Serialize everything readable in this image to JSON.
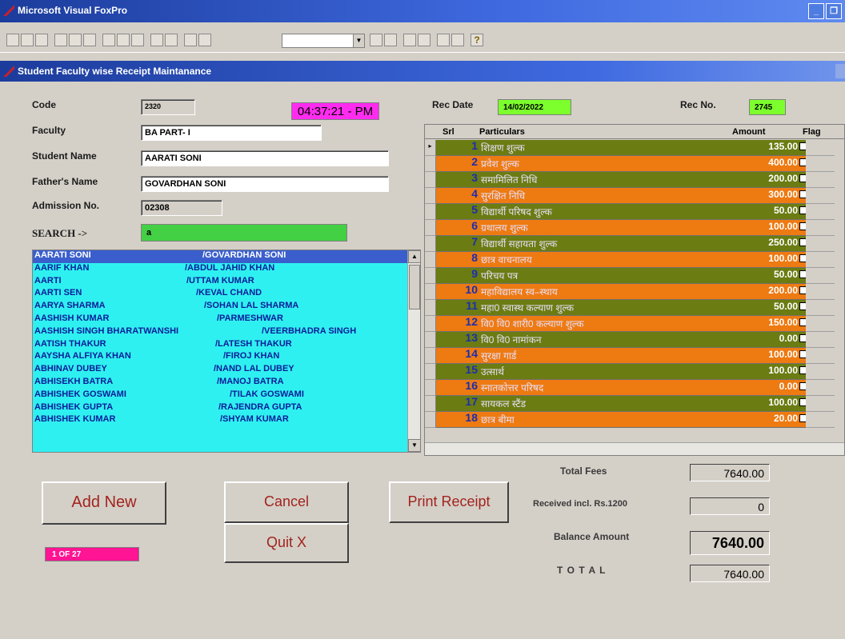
{
  "app": {
    "title": "Microsoft Visual FoxPro"
  },
  "form": {
    "title": "Student Faculty wise Receipt Maintanance"
  },
  "labels": {
    "code": "Code",
    "faculty": "Faculty",
    "student_name": "Student Name",
    "father_name": "Father's Name",
    "admission_no": "Admission No.",
    "search": "SEARCH ->",
    "rec_date": "Rec Date",
    "rec_no": "Rec No.",
    "total_fees": "Total Fees",
    "received": "Received incl. Rs.1200",
    "balance": "Balance Amount",
    "total": "T O T A L"
  },
  "fields": {
    "code": "2320",
    "clock": "04:37:21 - PM",
    "faculty": "BA PART- I",
    "student_name": "AARATI SONI",
    "father_name": "GOVARDHAN SONI",
    "admission_no": "02308",
    "search": "a",
    "rec_date": "14/02/2022",
    "rec_no": "2745",
    "total_fees": "7640.00",
    "received": "0",
    "balance": "7640.00",
    "total": "7640.00",
    "record_pos": "1  OF   27"
  },
  "student_list": [
    {
      "name": "AARATI SONI",
      "father": "/GOVARDHAN SONI",
      "selected": true
    },
    {
      "name": "AARIF KHAN",
      "father": "/ABDUL JAHID KHAN"
    },
    {
      "name": "AARTI",
      "father": "/UTTAM KUMAR"
    },
    {
      "name": "AARTI SEN",
      "father": "/KEVAL CHAND"
    },
    {
      "name": "AARYA SHARMA",
      "father": "/SOHAN LAL SHARMA"
    },
    {
      "name": "AASHISH KUMAR",
      "father": "/PARMESHWAR"
    },
    {
      "name": "AASHISH SINGH BHARATWANSHI",
      "father": "/VEERBHADRA SINGH"
    },
    {
      "name": "AATISH THAKUR",
      "father": "/LATESH THAKUR"
    },
    {
      "name": "AAYSHA ALFIYA KHAN",
      "father": "/FIROJ KHAN"
    },
    {
      "name": "ABHINAV DUBEY",
      "father": "/NAND LAL DUBEY"
    },
    {
      "name": "ABHISEKH BATRA",
      "father": "/MANOJ BATRA"
    },
    {
      "name": "ABHISHEK GOSWAMI",
      "father": "/TILAK GOSWAMI"
    },
    {
      "name": "ABHISHEK GUPTA",
      "father": "/RAJENDRA GUPTA"
    },
    {
      "name": "ABHISHEK KUMAR",
      "father": "/SHYAM KUMAR"
    }
  ],
  "grid": {
    "headers": {
      "srl": "Srl",
      "particulars": "Particulars",
      "amount": "Amount",
      "flag": "Flag"
    },
    "rows": [
      {
        "srl": "1",
        "particular": "शिक्षण शुल्क",
        "amount": "135.00",
        "color": "#6b7c12"
      },
      {
        "srl": "2",
        "particular": "प्रवेश शुल्क",
        "amount": "400.00",
        "color": "#ee7a12"
      },
      {
        "srl": "3",
        "particular": "समामिलित निधि",
        "amount": "200.00",
        "color": "#6b7c12"
      },
      {
        "srl": "4",
        "particular": "सुरक्षित निधि",
        "amount": "300.00",
        "color": "#ee7a12"
      },
      {
        "srl": "5",
        "particular": "विद्यार्थी परिषद शुल्क",
        "amount": "50.00",
        "color": "#6b7c12"
      },
      {
        "srl": "6",
        "particular": "ग्रथालय शुल्क",
        "amount": "100.00",
        "color": "#ee7a12"
      },
      {
        "srl": "7",
        "particular": "विद्यार्थी सहायता शुल्क",
        "amount": "250.00",
        "color": "#6b7c12"
      },
      {
        "srl": "8",
        "particular": "छात्र वाचनालय",
        "amount": "100.00",
        "color": "#ee7a12"
      },
      {
        "srl": "9",
        "particular": "परिचय पत्र",
        "amount": "50.00",
        "color": "#6b7c12"
      },
      {
        "srl": "10",
        "particular": "महाविद्यालय स्व–स्थाय",
        "amount": "200.00",
        "color": "#ee7a12"
      },
      {
        "srl": "11",
        "particular": "महा0 स्वास्थ कल्याण शुल्क",
        "amount": "50.00",
        "color": "#6b7c12"
      },
      {
        "srl": "12",
        "particular": "वि0 वि0 शारी0 कल्याण शुल्क",
        "amount": "150.00",
        "color": "#ee7a12"
      },
      {
        "srl": "13",
        "particular": "वि0 वि0 नामांकन",
        "amount": "0.00",
        "color": "#6b7c12"
      },
      {
        "srl": "14",
        "particular": "सुरक्षा गार्ड",
        "amount": "100.00",
        "color": "#ee7a12"
      },
      {
        "srl": "15",
        "particular": "उत्सार्थ",
        "amount": "100.00",
        "color": "#6b7c12"
      },
      {
        "srl": "16",
        "particular": "स्नातकोत्तर परिषद",
        "amount": "0.00",
        "color": "#ee7a12"
      },
      {
        "srl": "17",
        "particular": "सायकल स्टैंड",
        "amount": "100.00",
        "color": "#6b7c12"
      },
      {
        "srl": "18",
        "particular": "छात्र बीमा",
        "amount": "20.00",
        "color": "#ee7a12"
      }
    ]
  },
  "buttons": {
    "add_new": "Add New",
    "cancel": "Cancel",
    "print_receipt": "Print Receipt",
    "quit": "Quit X"
  }
}
